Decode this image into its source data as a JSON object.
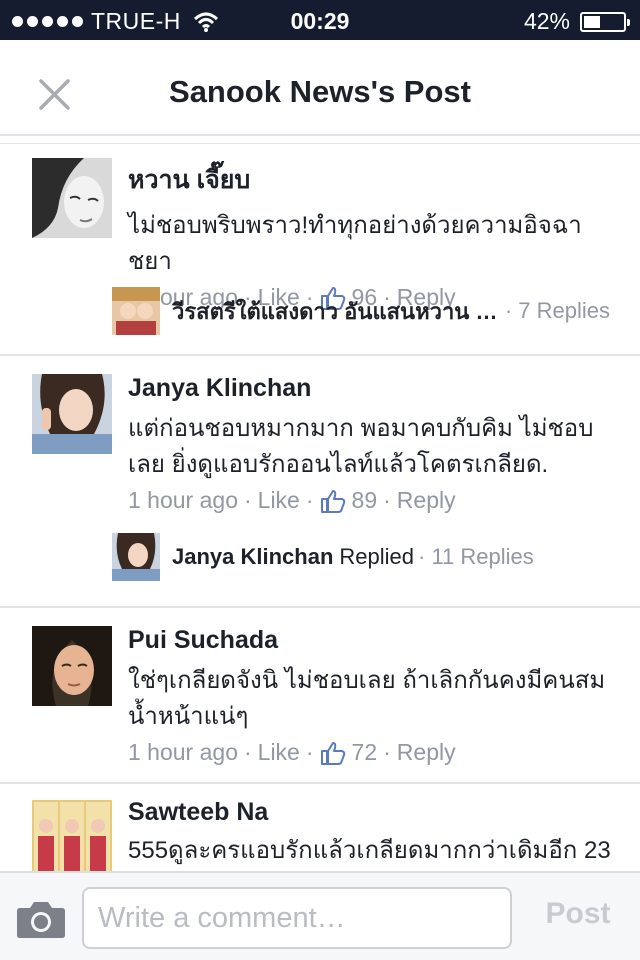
{
  "status_bar": {
    "carrier": "TRUE-H",
    "time": "00:29",
    "battery": "42%",
    "battery_level": 0.42
  },
  "header": {
    "title": "Sanook News's Post"
  },
  "comments": [
    {
      "name": "หวาน เจี๊ยบ",
      "text": "ไม่ชอบพริบพราว!ทำทุกอย่างด้วยความอิจฉาชยา",
      "time": "1 hour ago",
      "like_label": "Like",
      "like_count": "96",
      "reply_label": "Reply",
      "reply_preview": {
        "name": "วีรสตรีใต้แสงดาว อันแสนหวาน R…",
        "extra": "",
        "count": "7 Replies"
      }
    },
    {
      "name": "Janya Klinchan",
      "text": "แต่ก่อนชอบหมากมาก พอมาคบกับคิม ไม่ชอบเลย ยิ่งดูแอบรักออนไลท์แล้วโคตรเกลียด.",
      "time": "1 hour ago",
      "like_label": "Like",
      "like_count": "89",
      "reply_label": "Reply",
      "reply_preview": {
        "name": "Janya Klinchan",
        "extra": "Replied",
        "count": "11 Replies"
      }
    },
    {
      "name": "Pui Suchada",
      "text": "ใช่ๆเกลียดจังนิ ไม่ชอบเลย ถ้าเลิกกันคงมีคนสมน้ำหน้าแน่ๆ",
      "time": "1 hour ago",
      "like_label": "Like",
      "like_count": "72",
      "reply_label": "Reply"
    },
    {
      "name": "Sawteeb Na",
      "text": "555ดูละครแอบรักแล้วเกลียดมากกว่าเดิมอีก 23"
    }
  ],
  "composer": {
    "placeholder": "Write a comment…",
    "post_label": "Post"
  },
  "icons": {
    "close": "close-icon",
    "like": "thumbs-up-icon",
    "camera": "camera-icon",
    "wifi": "wifi-icon",
    "battery": "battery-icon"
  },
  "colors": {
    "status_bar_bg": "#151c2f",
    "meta_text": "#9197a3",
    "like_blue": "#5b7bc0"
  }
}
